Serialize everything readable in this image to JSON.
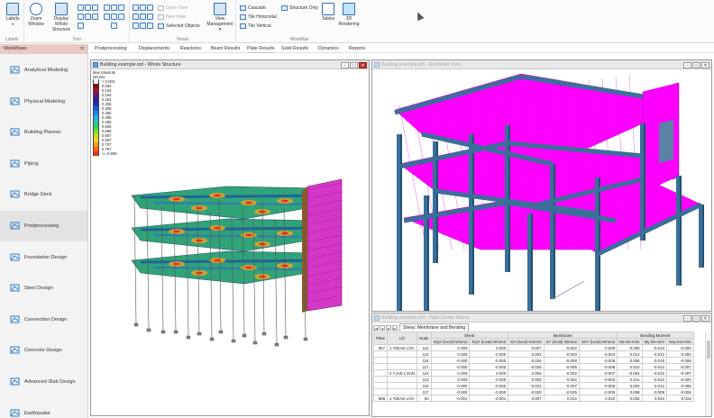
{
  "ribbon": {
    "groups": {
      "labels": "Labels",
      "tool": "Tool",
      "views": "Views",
      "workflow": "Workflow"
    },
    "buttons": {
      "labels": "Labels",
      "zoom_window_1": "Zoom",
      "zoom_window_2": "Window",
      "display_whole_1": "Display",
      "display_whole_2": "Whole Structure",
      "open_view": "Open View",
      "new_view": "New View",
      "selected_objects": "Selected Objects",
      "view_management_1": "View",
      "view_management_2": "Management",
      "cascade": "Cascade",
      "tile_horizontal": "Tile Horizontal",
      "tile_vertical": "Tile Vertical",
      "structure_only": "Structure Only",
      "tables": "Tables",
      "rendering_1": "3D",
      "rendering_2": "Rendering"
    }
  },
  "tabs": [
    "Postprocessing",
    "Displacements",
    "Reactions",
    "Beam Results",
    "Plate Results",
    "Solid Results",
    "Dynamics",
    "Reports"
  ],
  "active_tab": 4,
  "sidebar": {
    "title": "Workflows",
    "items": [
      {
        "label": "Analytical Modeling",
        "icon": "analytical-modeling-icon"
      },
      {
        "label": "Physical Modeling",
        "icon": "physical-modeling-icon"
      },
      {
        "label": "Building Planner",
        "icon": "building-planner-icon"
      },
      {
        "label": "Piping",
        "icon": "piping-icon"
      },
      {
        "label": "Bridge Deck",
        "icon": "bridge-deck-icon"
      },
      {
        "label": "Postprocessing",
        "icon": "postprocessing-icon"
      },
      {
        "label": "Foundation Design",
        "icon": "foundation-design-icon"
      },
      {
        "label": "Steel Design",
        "icon": "steel-design-icon"
      },
      {
        "label": "Connection Design",
        "icon": "connection-design-icon"
      },
      {
        "label": "Concrete Design",
        "icon": "concrete-design-icon"
      },
      {
        "label": "Advanced Slab Design",
        "icon": "advanced-slab-design-icon"
      },
      {
        "label": "Earthquake",
        "icon": "earthquake-icon"
      }
    ],
    "active_index": 5
  },
  "window_whole": {
    "title": "Building example.std - Whole Structure",
    "legend_title": "Max Absolute",
    "legend_unit": "N/mm2",
    "legend": [
      {
        "label": "< 0.003",
        "color": "#ffffff"
      },
      {
        "label": "0.054",
        "color": "#7a0f0f"
      },
      {
        "label": "0.104",
        "color": "#a8102a"
      },
      {
        "label": "0.154",
        "color": "#5a1a6a"
      },
      {
        "label": "0.204",
        "color": "#2b1d8a"
      },
      {
        "label": "0.255",
        "color": "#1f2fb4"
      },
      {
        "label": "0.305",
        "color": "#1e5ad8"
      },
      {
        "label": "0.355",
        "color": "#1f86e8"
      },
      {
        "label": "0.405",
        "color": "#21b0e8"
      },
      {
        "label": "0.456",
        "color": "#22c8b4"
      },
      {
        "label": "0.506",
        "color": "#2bd06a"
      },
      {
        "label": "0.556",
        "color": "#7ad63a"
      },
      {
        "label": "0.607",
        "color": "#c8d82a"
      },
      {
        "label": "0.657",
        "color": "#f0d028"
      },
      {
        "label": "0.707",
        "color": "#f59a22"
      },
      {
        "label": "0.757",
        "color": "#f26a1e"
      },
      {
        "label": ">= 0.808",
        "color": "#e6341a"
      }
    ]
  },
  "window_render": {
    "title": "Building example.std - Rendered View"
  },
  "window_table": {
    "title": "Building example.std - Plate Center Stress",
    "tab": "Shear, Membrane and Bending",
    "group_headers": [
      "Shear",
      "Membrane",
      "Bending Moment"
    ],
    "headers": [
      "Plate",
      "L/C",
      "Node",
      "SQX (local) N/mm2",
      "SQY (local) N/mm2",
      "SX (local) N/mm2",
      "SY (local) N/mm2",
      "SXY (local) N/mm2",
      "Mx kN·m/m",
      "My kN·m/m",
      "Mxy kN·m/m"
    ],
    "rows": [
      [
        "557",
        "1 *DEAD LOA",
        "114",
        "0.000",
        "0.000",
        "0.007",
        "-0.002",
        "-0.009",
        "-0.005",
        "-0.013",
        "-0.000"
      ],
      [
        "",
        "",
        "113",
        "0.000",
        "-0.000",
        "0.004",
        "-0.003",
        "-0.004",
        "0.014",
        "-0.012",
        "-0.000"
      ],
      [
        "",
        "",
        "116",
        "-0.000",
        "-0.000",
        "-0.026",
        "-0.009",
        "-0.006",
        "0.005",
        "-0.015",
        "-0.008"
      ],
      [
        "",
        "",
        "117",
        "-0.000",
        "-0.000",
        "-0.025",
        "-0.005",
        "-0.006",
        "0.010",
        "-0.012",
        "-0.007"
      ],
      [
        "",
        "2 *LIVE LOAD",
        "114",
        "0.000",
        "0.000",
        "0.006",
        "-0.002",
        "-0.007",
        "-0.004",
        "-0.010",
        "-0.007"
      ],
      [
        "",
        "",
        "113",
        "0.000",
        "-0.000",
        "0.003",
        "-0.002",
        "-0.003",
        "0.011",
        "-0.010",
        "-0.000"
      ],
      [
        "",
        "",
        "116",
        "-0.000",
        "-0.000",
        "-0.023",
        "-0.007",
        "-0.005",
        "0.004",
        "-0.012",
        "-0.006"
      ],
      [
        "",
        "",
        "117",
        "-0.000",
        "-0.000",
        "-0.020",
        "-0.005",
        "-0.005",
        "0.008",
        "-0.009",
        "-0.006"
      ],
      [
        "558",
        "1 *DEAD LOA",
        "63",
        "-0.001",
        "-0.001",
        "0.007",
        "0.014",
        "0.010",
        "0.035",
        "0.044",
        "0.016"
      ]
    ]
  }
}
